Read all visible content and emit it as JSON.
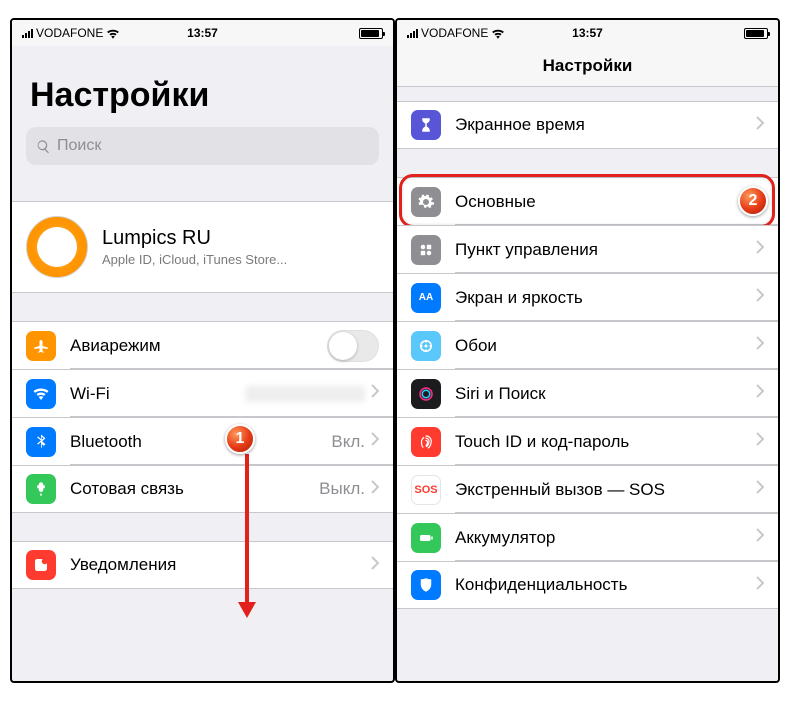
{
  "status": {
    "carrier": "VODAFONE",
    "time": "13:57"
  },
  "left": {
    "title": "Настройки",
    "searchPlaceholder": "Поиск",
    "profile": {
      "name": "Lumpics RU",
      "subtitle": "Apple ID, iCloud, iTunes Store..."
    },
    "rows": {
      "airplane": "Авиарежим",
      "wifi": "Wi-Fi",
      "wifiValue": "",
      "bluetooth": "Bluetooth",
      "bluetoothValue": "Вкл.",
      "cellular": "Сотовая связь",
      "cellularValue": "Выкл.",
      "notifications": "Уведомления"
    }
  },
  "right": {
    "navTitle": "Настройки",
    "rows": {
      "screentime": "Экранное время",
      "general": "Основные",
      "controlcenter": "Пункт управления",
      "display": "Экран и яркость",
      "wallpaper": "Обои",
      "siri": "Siri и Поиск",
      "touchid": "Touch ID и код-пароль",
      "sos": "Экстренный вызов — SOS",
      "battery": "Аккумулятор",
      "privacy": "Конфиденциальность"
    }
  },
  "badges": {
    "one": "1",
    "two": "2"
  }
}
